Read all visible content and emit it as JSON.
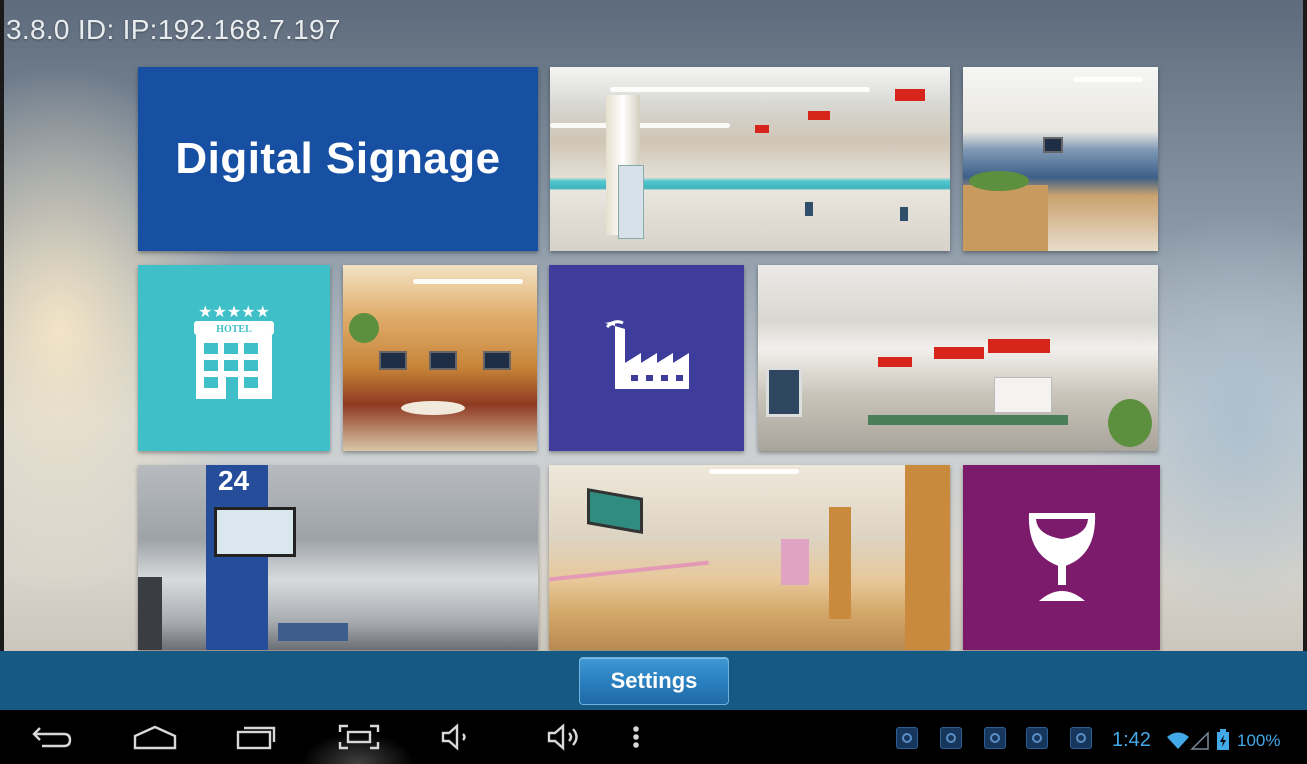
{
  "status": {
    "version_text": "3.8.0 ID: IP:192.168.7.197"
  },
  "tiles": {
    "digital_signage_label": "Digital Signage",
    "bank_hall_icon": "photo-bank-hall",
    "waiting_lobby_icon": "photo-waiting-lobby",
    "hotel_icon": "hotel-icon",
    "hotel_room_icon": "photo-hotel-lounge",
    "factory_icon": "factory-icon",
    "bank_counter_icon": "photo-bank-counter",
    "airport_icon": "photo-airport",
    "hospital_icon": "photo-hospital-corridor",
    "bar_icon": "wine-glass-icon"
  },
  "bottom": {
    "settings_label": "Settings"
  },
  "navbar": {
    "back_icon": "back-icon",
    "home_icon": "home-icon",
    "recents_icon": "recent-apps-icon",
    "screenshot_icon": "screenshot-icon",
    "volume_down_icon": "volume-down-icon",
    "volume_up_icon": "volume-up-icon",
    "menu_icon": "menu-icon"
  },
  "status_bar": {
    "time": "1:42",
    "battery": "100%",
    "notification_icon": "notification-app-icon"
  },
  "colors": {
    "signage_blue": "#1750a3",
    "hotel_teal": "#3fbfc8",
    "factory_indigo": "#3e3d9b",
    "wine_purple": "#7c1a6c",
    "band_blue": "#165a84",
    "status_blue": "#43a8e8"
  }
}
